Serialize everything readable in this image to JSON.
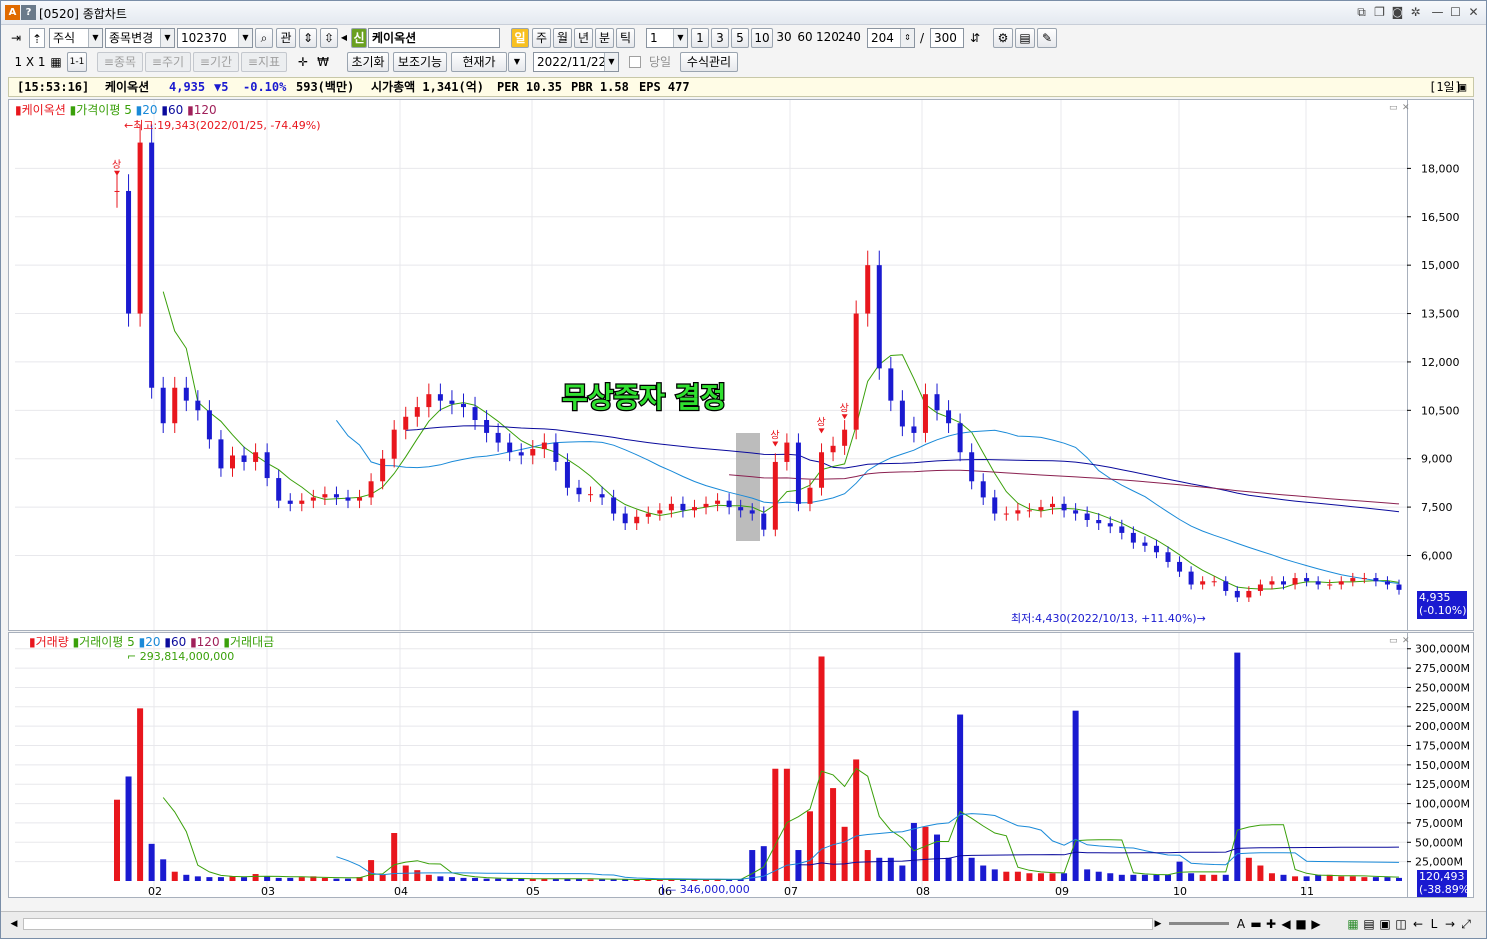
{
  "window": {
    "title": "[0520] 종합차트",
    "badge_a": "A",
    "badge_q": "?"
  },
  "toolbar1": {
    "market": "주식",
    "change_item": "종목변경",
    "code": "102370",
    "relation": "관",
    "new_badge": "신",
    "stock_name": "케이옥션",
    "period_active": "일",
    "periods": [
      "주",
      "월",
      "년",
      "분",
      "틱"
    ],
    "interval": "1",
    "intervals": [
      "1",
      "3",
      "5",
      "10",
      "30",
      "60",
      "120",
      "240"
    ],
    "count": "204",
    "count_sep": "/",
    "count_total": "300"
  },
  "toolbar2": {
    "layout": "1 X 1",
    "layout_small": "1-1",
    "btn_item": "≡종목",
    "btn_period": "≡주기",
    "btn_range": "≡기간",
    "btn_indicator": "≡지표",
    "reset": "초기화",
    "aux": "보조기능",
    "price_type": "현재가",
    "date": "2022/11/22",
    "same_day": "당일",
    "formula": "수식관리"
  },
  "infobar": {
    "time": "[15:53:16]",
    "name": "케이옥션",
    "price": "4,935",
    "change": "▼5",
    "pct": "-0.10%",
    "vol": "593(백만)",
    "mcap": "시가총액 1,341(억)",
    "per": "PER 10.35",
    "pbr": "PBR 1.58",
    "eps": "EPS 477",
    "period": "[1일]"
  },
  "price_legend": [
    {
      "label": "케이옥션",
      "color": "#e8161d"
    },
    {
      "label": "가격이평 5",
      "color": "#3aa00a"
    },
    {
      "label": "20",
      "color": "#1a8ad8"
    },
    {
      "label": "60",
      "color": "#0a0a9c"
    },
    {
      "label": "120",
      "color": "#a0205a"
    }
  ],
  "vol_legend": [
    {
      "label": "거래량",
      "color": "#e8161d"
    },
    {
      "label": "거래이평 5",
      "color": "#3aa00a"
    },
    {
      "label": "20",
      "color": "#1a8ad8"
    },
    {
      "label": "60",
      "color": "#0a0a9c"
    },
    {
      "label": "120",
      "color": "#a0205a"
    },
    {
      "label": "거래대금",
      "color": "#3aa00a"
    }
  ],
  "annotations": {
    "high": "←최고:19,343(2022/01/25, -74.49%)",
    "low": "최저:4,430(2022/10/13, +11.40%)→",
    "headline": "무상증자 결정",
    "vol_high": "293,814,000,000",
    "vol_low": "346,000,000",
    "cur_price": "4,935",
    "cur_pct": "(-0.10%)",
    "cur_vol": "120,493",
    "cur_vol_pct": "(-38.89%)",
    "marker": "상"
  },
  "colors": {
    "up": "#e8161d",
    "down": "#1a1ad0",
    "ma5": "#3aa00a",
    "ma20": "#1a8ad8",
    "ma60": "#0a0a9c",
    "ma120": "#8a2050",
    "headline_fill": "#30e030"
  },
  "chart_data": [
    {
      "type": "candlestick",
      "title": "",
      "x_labels": [
        "02",
        "03",
        "04",
        "05",
        "06",
        "07",
        "08",
        "09",
        "10",
        "11"
      ],
      "y_ticks": [
        "18,000",
        "16,500",
        "15,000",
        "13,500",
        "12,000",
        "10,500",
        "9,000",
        "7,500",
        "6,000"
      ],
      "ylim": [
        4000,
        19500
      ],
      "log_scale": false,
      "grid": true,
      "series": [
        {
          "name": "케이옥션",
          "values": [
            17300,
            13500,
            18800,
            11200,
            10100,
            11200,
            10800,
            10500,
            9600,
            8700,
            9100,
            8900,
            9200,
            8400,
            7700,
            7600,
            7700,
            7800,
            7900,
            7800,
            7700,
            7800,
            8300,
            9000,
            9900,
            10300,
            10600,
            11000,
            10800,
            10700,
            10600,
            10200,
            9800,
            9500,
            9200,
            9100,
            9300,
            9500,
            8900,
            8100,
            7900,
            7900,
            7800,
            7300,
            7000,
            7200,
            7300,
            7400,
            7600,
            7400,
            7500,
            7600,
            7700,
            7500,
            7400,
            7300,
            6800,
            8900,
            9500,
            7600,
            8100,
            9200,
            9400,
            9900,
            13500,
            15000,
            11800,
            10800,
            10000,
            9800,
            11000,
            10500,
            10100,
            9200,
            8300,
            7800,
            7300,
            7300,
            7400,
            7400,
            7500,
            7600,
            7400,
            7300,
            7100,
            7000,
            6900,
            6700,
            6400,
            6300,
            6100,
            5800,
            5500,
            5100,
            5200,
            5200,
            4900,
            4700,
            4900,
            5100,
            5200,
            5100,
            5300,
            5200,
            5100,
            5100,
            5200,
            5300,
            5300,
            5200,
            5100,
            4935
          ]
        }
      ]
    },
    {
      "type": "bar",
      "title": "",
      "y_ticks": [
        "300,000M",
        "275,000M",
        "250,000M",
        "225,000M",
        "200,000M",
        "175,000M",
        "150,000M",
        "125,000M",
        "100,000M",
        "75,000M",
        "50,000M",
        "25,000M"
      ],
      "ylim": [
        0,
        310000
      ],
      "unit": "M",
      "series": [
        {
          "name": "거래량",
          "values": [
            105000,
            135000,
            223000,
            48000,
            28000,
            12000,
            8000,
            6000,
            5000,
            5000,
            6000,
            5000,
            9000,
            6000,
            4000,
            4000,
            5000,
            6000,
            4000,
            3000,
            3000,
            5000,
            27000,
            8000,
            62000,
            20000,
            14000,
            8000,
            6000,
            5000,
            4000,
            4000,
            3000,
            3000,
            3000,
            3000,
            3000,
            3000,
            3000,
            3000,
            3000,
            2000,
            2000,
            2000,
            2000,
            2000,
            2000,
            2000,
            2000,
            2000,
            2000,
            2000,
            2000,
            2000,
            2000,
            40000,
            45000,
            145000,
            145000,
            40000,
            90000,
            290000,
            120000,
            70000,
            157000,
            40000,
            30000,
            30000,
            20000,
            75000,
            70000,
            60000,
            30000,
            215000,
            30000,
            20000,
            15000,
            12000,
            12000,
            10000,
            10000,
            10000,
            10000,
            220000,
            15000,
            12000,
            10000,
            8000,
            8000,
            8000,
            8000,
            8000,
            25000,
            10000,
            8000,
            8000,
            8000,
            295000,
            30000,
            20000,
            10000,
            8000,
            6000,
            6000,
            8000,
            8000,
            6000,
            6000,
            5000,
            5000,
            5000,
            4000
          ]
        }
      ]
    }
  ],
  "bottom": {
    "scroll_left": "◀",
    "scroll_right": "▶"
  }
}
